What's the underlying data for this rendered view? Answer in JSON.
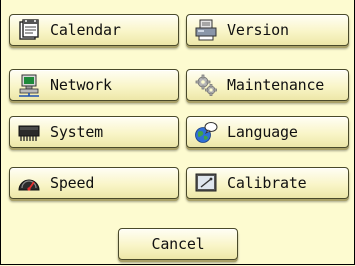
{
  "menu": {
    "items": [
      {
        "id": "calendar",
        "label": "Calendar",
        "icon": "calendar-icon"
      },
      {
        "id": "version",
        "label": "Version",
        "icon": "printer-version-icon"
      },
      {
        "id": "network",
        "label": "Network",
        "icon": "network-computer-icon"
      },
      {
        "id": "maintenance",
        "label": "Maintenance",
        "icon": "gears-icon"
      },
      {
        "id": "system",
        "label": "System",
        "icon": "chip-icon"
      },
      {
        "id": "language",
        "label": "Language",
        "icon": "globe-speech-icon"
      },
      {
        "id": "speed",
        "label": "Speed",
        "icon": "speedometer-icon"
      },
      {
        "id": "calibrate",
        "label": "Calibrate",
        "icon": "screen-calibrate-icon"
      }
    ]
  },
  "footer": {
    "cancel_label": "Cancel"
  },
  "colors": {
    "background": "#fdfbd0",
    "button_face": "#f9f5c8",
    "button_border": "#4a4a2a"
  }
}
